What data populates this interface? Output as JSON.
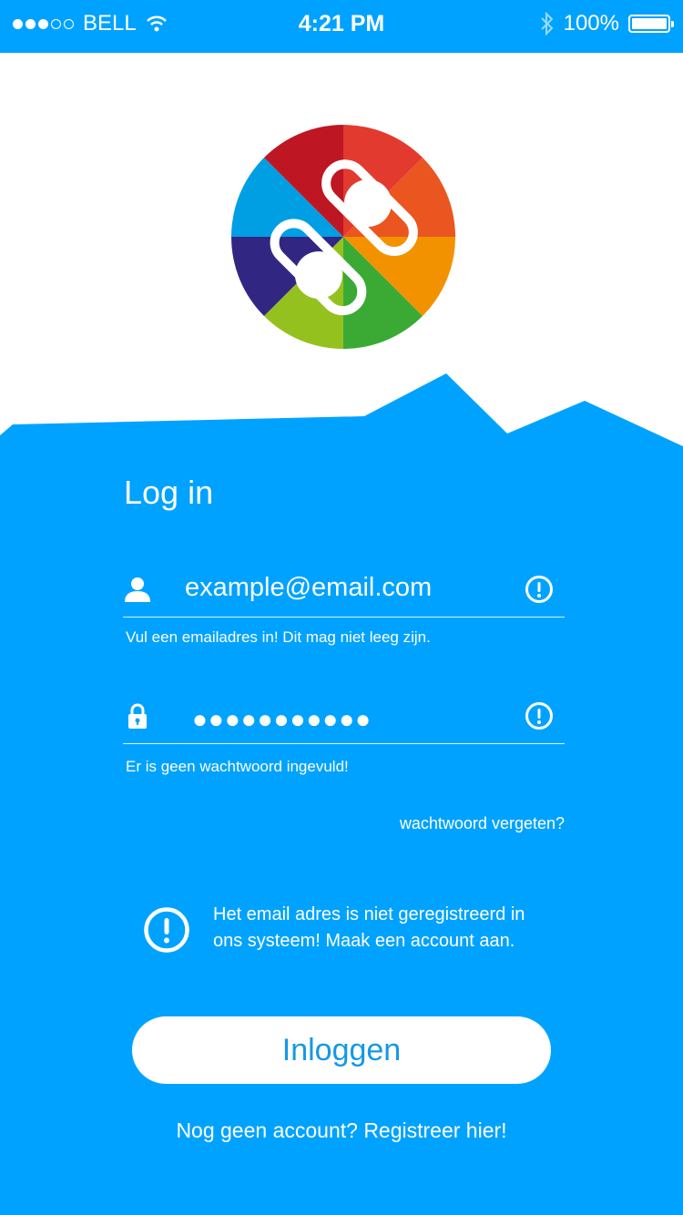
{
  "status_bar": {
    "carrier": "BELL",
    "time": "4:21 PM",
    "battery": "100%",
    "signal_bars": 3,
    "signal_total": 5,
    "icons": [
      "wifi-icon",
      "bluetooth-icon",
      "battery-icon"
    ]
  },
  "colors": {
    "primary_blue": "#00a2ff",
    "button_text": "#1498e6",
    "logo_segments": [
      "#e33a2f",
      "#ea5520",
      "#f39200",
      "#3aaa35",
      "#95c11f",
      "#312783",
      "#009ee3",
      "#be1622"
    ]
  },
  "login": {
    "title": "Log in",
    "email_value": "example@email.com",
    "email_hint": "Vul een emailadres in! Dit mag niet leeg zijn.",
    "password_value": "●●●●●●●●●●●",
    "password_hint": "Er is geen wachtwoord ingevuld!",
    "forgot_label": "wachtwoord vergeten?",
    "error_message_line1": "Het email adres is niet geregistreerd in",
    "error_message_line2": "ons systeem! Maak een account aan.",
    "button_label": "Inloggen",
    "register_label": "Nog geen account? Registreer hier!"
  }
}
